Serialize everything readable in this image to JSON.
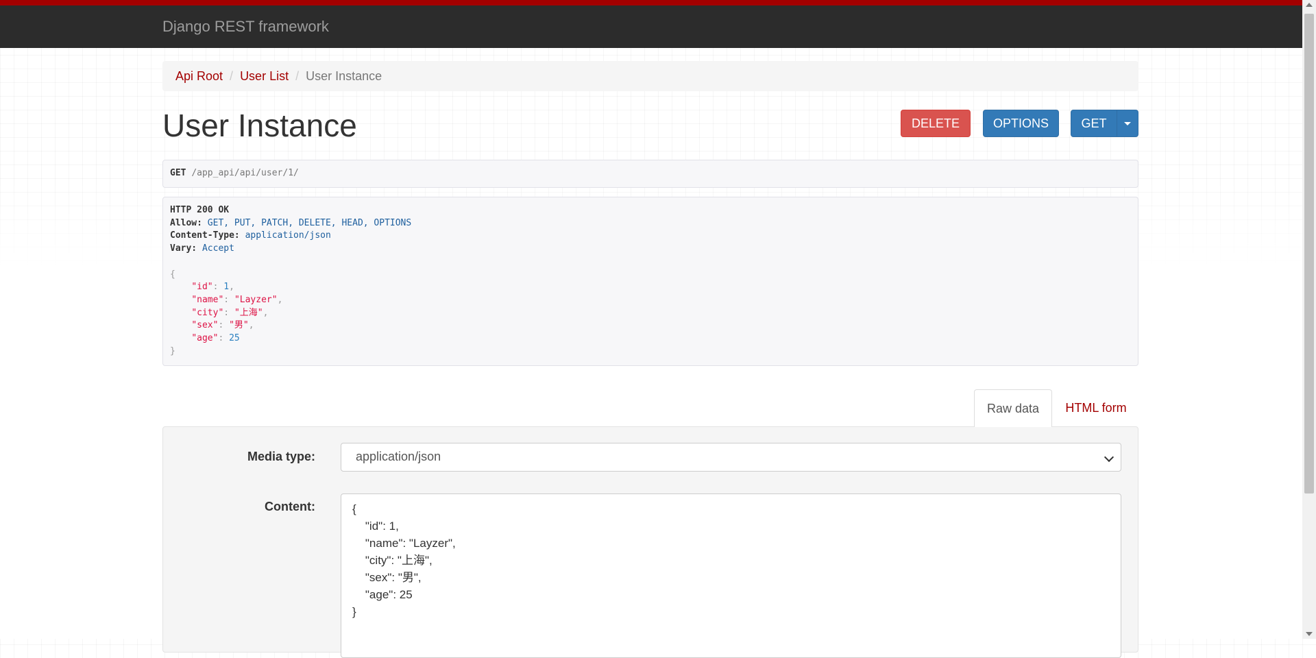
{
  "brand": "Django REST framework",
  "breadcrumb": {
    "items": [
      "Api Root",
      "User List"
    ],
    "active": "User Instance",
    "separator": "/"
  },
  "page_title": "User Instance",
  "buttons": {
    "delete": "DELETE",
    "options": "OPTIONS",
    "get": "GET"
  },
  "request": {
    "method": "GET",
    "path": "/app_api/api/user/1/"
  },
  "response": {
    "status": "HTTP 200 OK",
    "headers": [
      {
        "name": "Allow:",
        "value": "GET, PUT, PATCH, DELETE, HEAD, OPTIONS"
      },
      {
        "name": "Content-Type:",
        "value": "application/json"
      },
      {
        "name": "Vary:",
        "value": "Accept"
      }
    ],
    "body": {
      "open": "{",
      "close": "}",
      "fields": [
        {
          "key": "\"id\"",
          "value": "1",
          "kind": "number",
          "comma": ","
        },
        {
          "key": "\"name\"",
          "value": "\"Layzer\"",
          "kind": "string",
          "comma": ","
        },
        {
          "key": "\"city\"",
          "value": "\"上海\"",
          "kind": "string",
          "comma": ","
        },
        {
          "key": "\"sex\"",
          "value": "\"男\"",
          "kind": "string",
          "comma": ","
        },
        {
          "key": "\"age\"",
          "value": "25",
          "kind": "number",
          "comma": ""
        }
      ]
    }
  },
  "tabs": {
    "raw": "Raw data",
    "html": "HTML form"
  },
  "form": {
    "media_type_label": "Media type:",
    "media_type_value": "application/json",
    "content_label": "Content:",
    "content_value": "{\n    \"id\": 1,\n    \"name\": \"Layzer\",\n    \"city\": \"上海\",\n    \"sex\": \"男\",\n    \"age\": 25\n}"
  },
  "colors": {
    "navbar": "#2c2c2c",
    "stripe": "#a30000",
    "link": "#a30000",
    "delete": "#d9534f",
    "primary": "#337ab7"
  }
}
